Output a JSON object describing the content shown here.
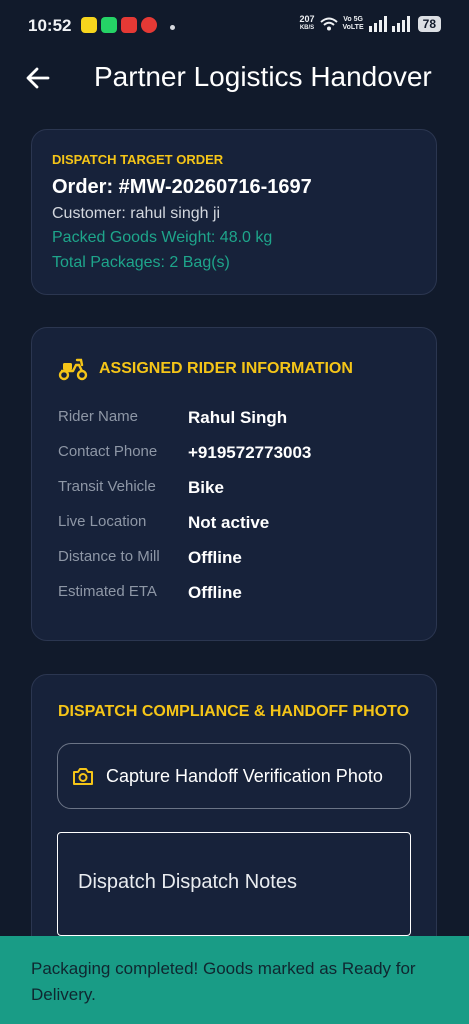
{
  "status_bar": {
    "time": "10:52",
    "net_speed_value": "207",
    "net_speed_unit": "KB/S",
    "volte_top": "Vo 5G",
    "volte_bottom": "VoLTE",
    "battery": "78",
    "app_icon_colors": [
      "#f7d51d",
      "#25d366",
      "#e53935",
      "#e53935"
    ]
  },
  "app_bar": {
    "title": "Partner Logistics Handover",
    "back_icon": "arrow-left-icon"
  },
  "order_card": {
    "label": "DISPATCH TARGET ORDER",
    "order": "Order: #MW-20260716-1697",
    "customer": "Customer: rahul singh ji",
    "weight": "Packed Goods Weight: 48.0 kg",
    "packages": "Total Packages: 2 Bag(s)"
  },
  "rider_card": {
    "icon": "scooter-icon",
    "heading": "ASSIGNED RIDER INFORMATION",
    "rows": [
      {
        "label": "Rider Name",
        "value": "Rahul Singh"
      },
      {
        "label": "Contact Phone",
        "value": "+919572773003"
      },
      {
        "label": "Transit Vehicle",
        "value": "Bike"
      },
      {
        "label": "Live Location",
        "value": "Not active"
      },
      {
        "label": "Distance to Mill",
        "value": "Offline"
      },
      {
        "label": "Estimated ETA",
        "value": "Offline"
      }
    ]
  },
  "compliance_card": {
    "heading": "DISPATCH COMPLIANCE & HANDOFF PHOTO",
    "capture_button": "Capture Handoff Verification Photo",
    "camera_icon": "camera-icon",
    "notes_placeholder": "Dispatch Dispatch Notes"
  },
  "snackbar": {
    "message": "Packaging completed! Goods marked as Ready for Delivery."
  },
  "colors": {
    "background": "#111a2b",
    "card": "#17223a",
    "accent_yellow": "#f5c518",
    "accent_teal": "#1ea58b",
    "snackbar": "#199c86"
  }
}
